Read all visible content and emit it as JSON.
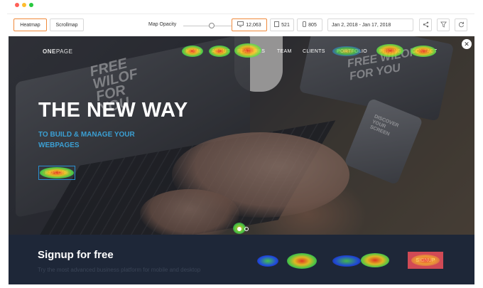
{
  "window": {
    "dots": [
      "#ff5f57",
      "#febc2e",
      "#28c840"
    ]
  },
  "toolbar": {
    "tabs": [
      {
        "label": "Heatmap",
        "active": true
      },
      {
        "label": "Scrollmap",
        "active": false
      }
    ],
    "opacity_label": "Map Opacity",
    "devices": [
      {
        "icon": "desktop-icon",
        "count": "12,063",
        "active": true
      },
      {
        "icon": "tablet-icon",
        "count": "521",
        "active": false
      },
      {
        "icon": "mobile-icon",
        "count": "805",
        "active": false
      }
    ],
    "date_range": "Jan 2, 2018 - Jan 17, 2018",
    "actions": [
      {
        "icon": "share-icon"
      },
      {
        "icon": "filter-icon"
      },
      {
        "icon": "refresh-icon"
      }
    ],
    "accent_color": "#f08a3b"
  },
  "site": {
    "brand_bold": "ONE",
    "brand_rest": "PAGE",
    "nav": [
      "HOME",
      "ABOUT",
      "FEATURES",
      "TEAM",
      "CLIENTS",
      "PORTFOLIO",
      "PRICING",
      "CONTACT"
    ],
    "headline": "THE NEW WAY",
    "sub_line1": "TO BUILD & MANAGE YOUR",
    "sub_line2": "WEBPAGES",
    "cta": "EXPLORE",
    "watermark_1": "FREE WILOF FOR YOU",
    "watermark_2": "FREE WILOF FOR YOU",
    "phone_text": "DISCOVER YOUR SCREEN",
    "close_icon": "close-icon",
    "signup_title": "Signup for free",
    "signup_sub": "Try the most advanced business platform for mobile and desktop",
    "signup_button": "SIGNUP",
    "heatmap_colors": {
      "hot": "#ff3b1f",
      "warm": "#ffd21f",
      "mid": "#4ee04a",
      "cool": "#1f4dff"
    }
  }
}
